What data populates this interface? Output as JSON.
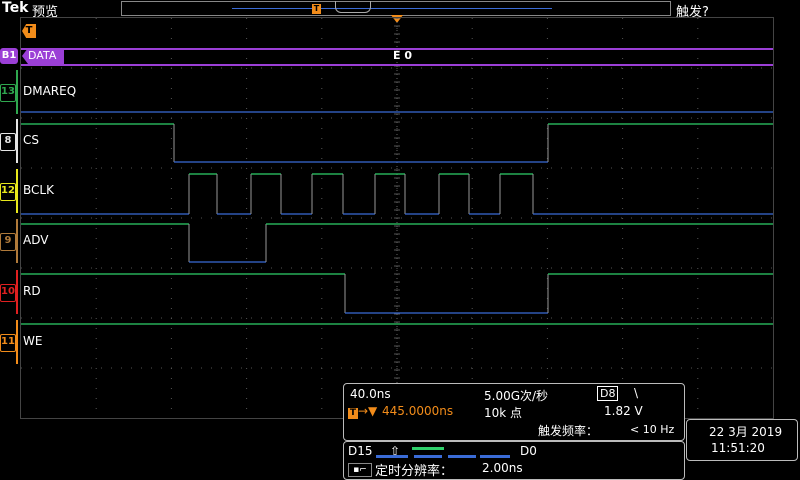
{
  "topbar": {
    "brand": "Tek",
    "mode": "预览",
    "trigger_status": "触发?"
  },
  "record": {
    "trigger_marker": "T"
  },
  "trigger_pos_marker": "T",
  "bus": {
    "marker": "B1",
    "label": "DATA",
    "decode_value": "E 0"
  },
  "channels": [
    {
      "marker": "13",
      "label": "DMAREQ",
      "color": "#2fa84f"
    },
    {
      "marker": "8",
      "label": "CS",
      "color": "#e6e6e6"
    },
    {
      "marker": "12",
      "label": "BCLK",
      "color": "#e8e81c"
    },
    {
      "marker": "9",
      "label": "ADV",
      "color": "#b07a3a"
    },
    {
      "marker": "10",
      "label": "RD",
      "color": "#e02020"
    },
    {
      "marker": "11",
      "label": "WE",
      "color": "#f28c1a"
    }
  ],
  "info": {
    "horizontal_scale": "40.0ns",
    "sample_rate": "5.00G次/秒",
    "trigger_source": "D8",
    "trigger_slope": "\\",
    "trigger_position": "445.0000ns",
    "record_length": "10k 点",
    "trigger_level": "1.82 V",
    "trigger_freq_label": "触发频率：",
    "trigger_freq_value": "< 10 Hz",
    "digital_high": "D15",
    "digital_low": "D0",
    "timing_resolution_label": "定时分辨率：",
    "timing_resolution_value": "2.00ns"
  },
  "datetime": {
    "date": "22 3月 2019",
    "time": "11:51:20"
  },
  "colors": {
    "bus": "#9b3fd6",
    "high_level": "#2fcf6a",
    "low_level": "#3a6bd6",
    "accent": "#f28c1a"
  }
}
